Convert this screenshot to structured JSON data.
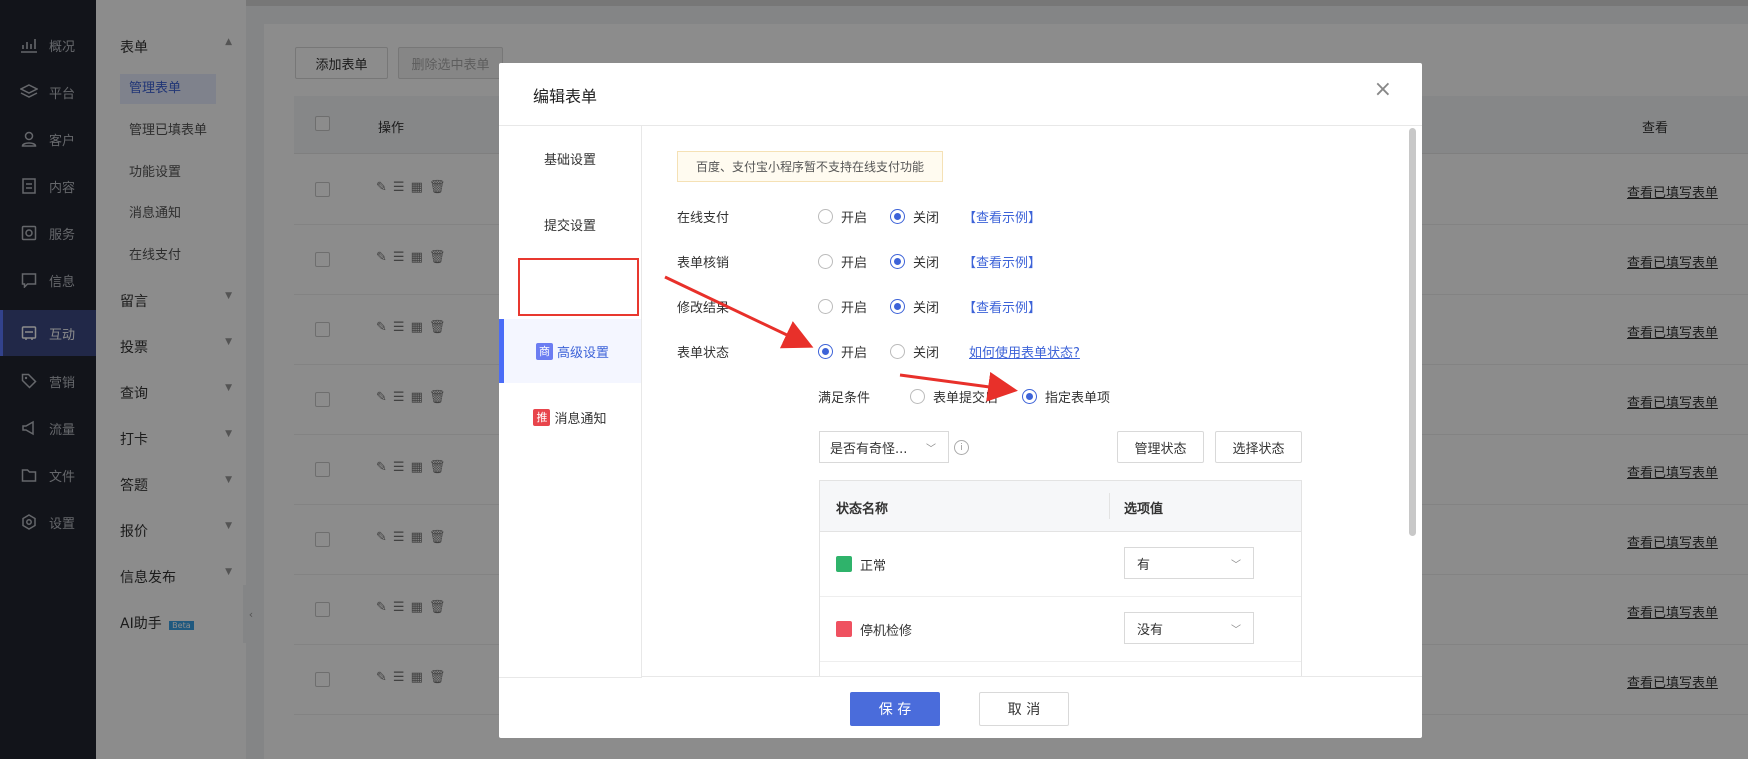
{
  "nav": {
    "items": [
      {
        "label": "概况",
        "icon": "chart-icon"
      },
      {
        "label": "平台",
        "icon": "layers-icon"
      },
      {
        "label": "客户",
        "icon": "user-icon"
      },
      {
        "label": "内容",
        "icon": "document-icon"
      },
      {
        "label": "服务",
        "icon": "service-icon"
      },
      {
        "label": "信息",
        "icon": "message-icon"
      },
      {
        "label": "互动",
        "icon": "interact-icon",
        "active": true
      },
      {
        "label": "营销",
        "icon": "tag-icon"
      },
      {
        "label": "流量",
        "icon": "megaphone-icon"
      },
      {
        "label": "文件",
        "icon": "folder-icon"
      },
      {
        "label": "设置",
        "icon": "settings-icon"
      }
    ]
  },
  "subnav": {
    "form_group": "表单",
    "form_items": [
      "管理表单",
      "管理已填表单",
      "功能设置",
      "消息通知",
      "在线支付"
    ],
    "groups": [
      "留言",
      "投票",
      "查询",
      "打卡",
      "答题",
      "报价",
      "信息发布"
    ],
    "ai_label": "AI助手",
    "ai_badge": "Beta"
  },
  "toolbar": {
    "add_label": "添加表单",
    "delete_label": "删除选中表单"
  },
  "table": {
    "col_action": "操作",
    "col_view": "查看",
    "view_link": "查看已填写表单",
    "row_count": 8
  },
  "modal": {
    "title": "编辑表单",
    "close": "×",
    "tabs": [
      {
        "label": "基础设置"
      },
      {
        "label": "提交设置"
      },
      {
        "label": "高级设置",
        "badge": "商",
        "badge_color": "#6c7df2",
        "active": true
      },
      {
        "label": "消息通知",
        "badge": "推",
        "badge_color": "#e8454c"
      }
    ],
    "notice": "百度、支付宝小程序暂不支持在线支付功能",
    "on": "开启",
    "off": "关闭",
    "example": "【查看示例】",
    "rows": [
      {
        "label": "在线支付",
        "value": "关闭"
      },
      {
        "label": "表单核销",
        "value": "关闭"
      },
      {
        "label": "修改结果",
        "value": "关闭"
      },
      {
        "label": "表单状态",
        "value": "开启",
        "help": "如何使用表单状态?"
      }
    ],
    "condition": {
      "label": "满足条件",
      "option1": "表单提交后",
      "option2": "指定表单项",
      "selected": "指定表单项"
    },
    "field_select": "是否有奇怪...",
    "manage_state": "管理状态",
    "choose_state": "选择状态",
    "state_table": {
      "col_name": "状态名称",
      "col_value": "选项值",
      "rows": [
        {
          "name": "正常",
          "color": "#2fb36b",
          "value": "有"
        },
        {
          "name": "停机检修",
          "color": "#ef5160",
          "value": "没有"
        }
      ]
    },
    "save": "保 存",
    "cancel": "取 消"
  },
  "accent": "#4a6cdb"
}
